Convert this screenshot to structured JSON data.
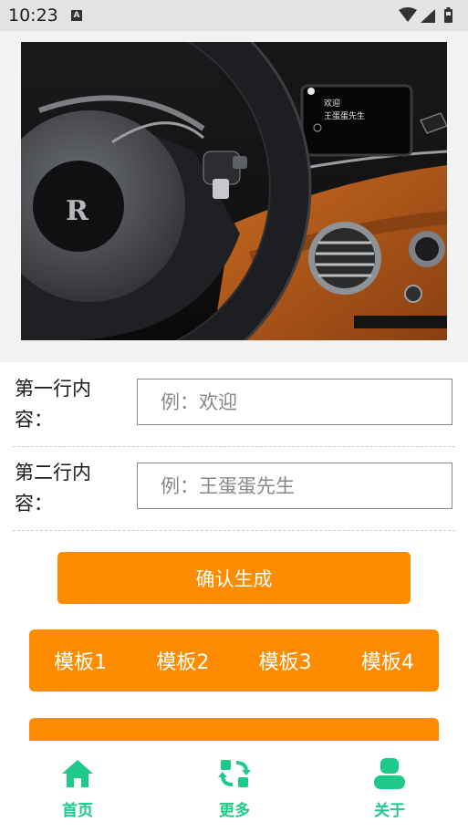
{
  "status_bar": {
    "time": "10:23",
    "notification_badge": "A"
  },
  "form": {
    "row1": {
      "label": "第一行内容：",
      "placeholder": "例：欢迎"
    },
    "row2": {
      "label": "第二行内容：",
      "placeholder": "例：王蛋蛋先生"
    }
  },
  "hero_image": {
    "screen_line1": "欢迎",
    "screen_line2": "王蛋蛋先生"
  },
  "confirm_button": "确认生成",
  "templates": [
    "模板1",
    "模板2",
    "模板3",
    "模板4"
  ],
  "bottom_nav": {
    "items": [
      {
        "label": "首页",
        "icon": "home-icon"
      },
      {
        "label": "更多",
        "icon": "refresh-icon"
      },
      {
        "label": "关于",
        "icon": "user-icon"
      }
    ],
    "active_color": "#1ec98a"
  },
  "colors": {
    "accent": "#ff8c00",
    "nav": "#1ec98a"
  }
}
